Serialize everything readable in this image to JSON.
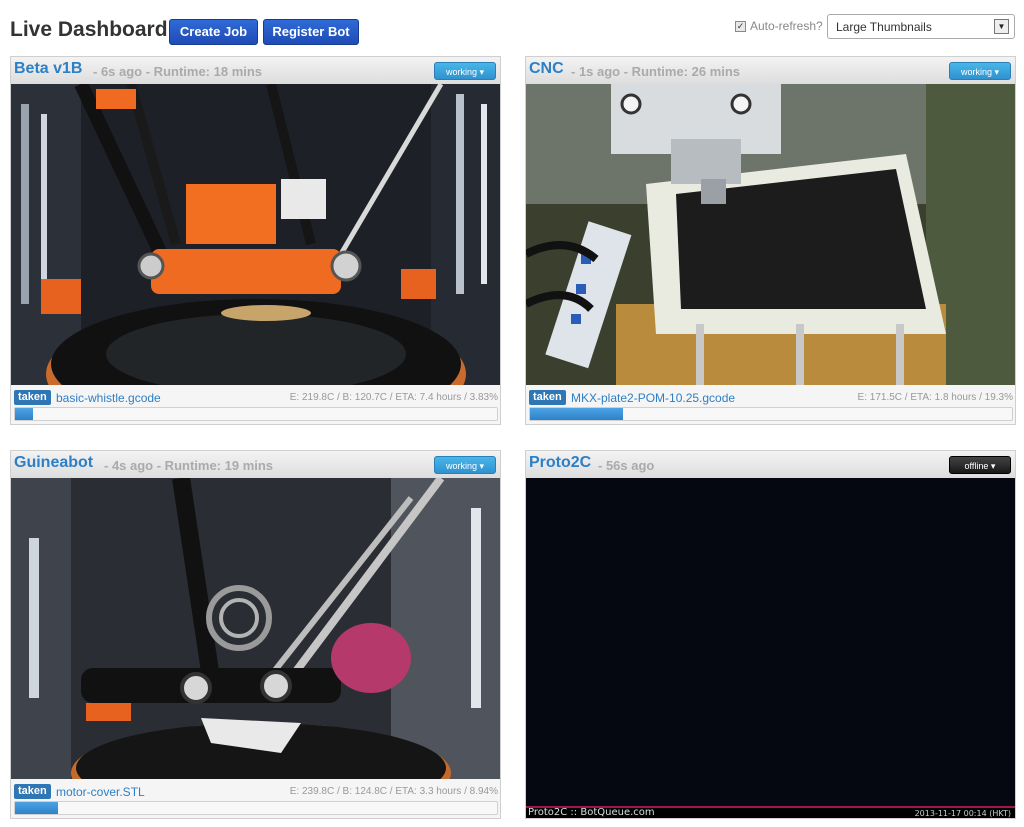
{
  "header": {
    "title": "Live Dashboard",
    "create_job_label": "Create Job",
    "register_bot_label": "Register Bot",
    "auto_refresh_label": "Auto-refresh?",
    "auto_refresh_checked": true,
    "view_select_value": "Large Thumbnails"
  },
  "bots": [
    {
      "name": "Beta v1B",
      "meta": "- 6s ago - Runtime: 18 mins",
      "status": "working",
      "job_tag": "taken",
      "job_name": "basic-whistle.gcode",
      "stats": "E: 219.8C / B: 120.7C / ETA: 7.4 hours / 3.83%",
      "progress": 3.83
    },
    {
      "name": "CNC",
      "meta": "- 1s ago - Runtime: 26 mins",
      "status": "working",
      "job_tag": "taken",
      "job_name": "MKX-plate2-POM-10.25.gcode",
      "stats": "E: 171.5C / ETA: 1.8 hours / 19.3%",
      "progress": 19.3
    },
    {
      "name": "Guineabot",
      "meta": "- 4s ago - Runtime: 19 mins",
      "status": "working",
      "job_tag": "taken",
      "job_name": "motor-cover.STL",
      "stats": "E: 239.8C / B: 124.8C / ETA: 3.3 hours / 8.94%",
      "progress": 8.94
    },
    {
      "name": "Proto2C",
      "meta": "- 56s ago",
      "status": "offline",
      "feed_caption_left": "Proto2C :: BotQueue.com",
      "feed_caption_right": "2013-11-17 00:14 (HKT)"
    }
  ],
  "icons": {
    "dropdown_caret": "caret-down-icon",
    "checkbox": "checkbox-icon"
  },
  "colors": {
    "link_blue": "#2d7fc6",
    "primary_button": "#1f4bb5",
    "working_badge": "#2f92cf",
    "offline_badge": "#181818",
    "progress_fill": "#2f81c8",
    "taken_badge": "#2f76b4"
  }
}
